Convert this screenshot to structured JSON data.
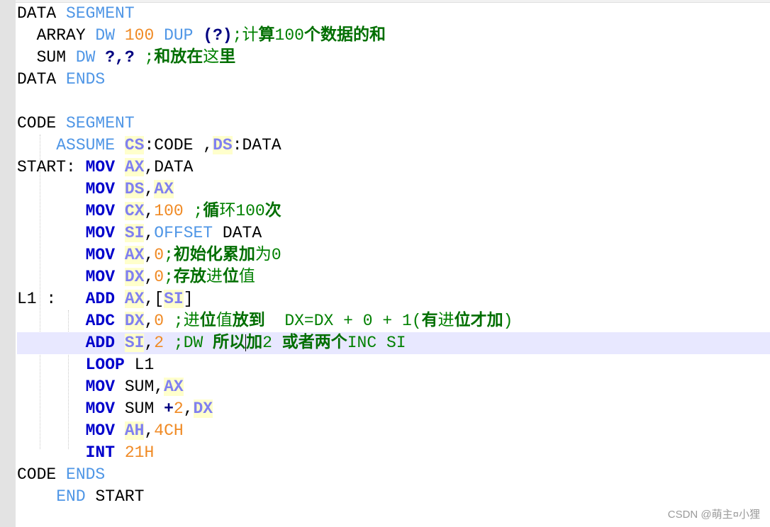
{
  "lines": [
    {
      "segs": [
        {
          "t": "DATA "
        },
        {
          "t": "SEGMENT",
          "c": "kw"
        }
      ]
    },
    {
      "segs": [
        {
          "t": "  ARRAY "
        },
        {
          "t": "DW",
          "c": "kw"
        },
        {
          "t": " "
        },
        {
          "t": "100",
          "c": "num"
        },
        {
          "t": " "
        },
        {
          "t": "DUP",
          "c": "kw"
        },
        {
          "t": " "
        },
        {
          "t": "(?)",
          "c": "punc"
        },
        {
          "t": ";计",
          "c": "cmt"
        },
        {
          "t": "算",
          "c": "cmt-b"
        },
        {
          "t": "100",
          "c": "cmt"
        },
        {
          "t": "个数据的和",
          "c": "cmt-b"
        }
      ]
    },
    {
      "segs": [
        {
          "t": "  SUM "
        },
        {
          "t": "DW",
          "c": "kw"
        },
        {
          "t": " "
        },
        {
          "t": "?,?",
          "c": "punc"
        },
        {
          "t": " "
        },
        {
          "t": ";",
          "c": "cmt"
        },
        {
          "t": "和放在",
          "c": "cmt-b"
        },
        {
          "t": "这",
          "c": "cmt"
        },
        {
          "t": "里",
          "c": "cmt-b"
        }
      ]
    },
    {
      "segs": [
        {
          "t": "DATA "
        },
        {
          "t": "ENDS",
          "c": "kw"
        }
      ]
    },
    {
      "segs": [
        {
          "t": ""
        }
      ]
    },
    {
      "segs": [
        {
          "t": "CODE "
        },
        {
          "t": "SEGMENT",
          "c": "kw"
        }
      ]
    },
    {
      "segs": [
        {
          "t": "    "
        },
        {
          "t": "ASSUME",
          "c": "kw"
        },
        {
          "t": " "
        },
        {
          "t": "CS",
          "c": "reg"
        },
        {
          "t": ":CODE ,"
        },
        {
          "t": "DS",
          "c": "reg"
        },
        {
          "t": ":DATA"
        }
      ]
    },
    {
      "segs": [
        {
          "t": "START: "
        },
        {
          "t": "MOV",
          "c": "op"
        },
        {
          "t": " "
        },
        {
          "t": "AX",
          "c": "reg"
        },
        {
          "t": ",DATA"
        }
      ]
    },
    {
      "segs": [
        {
          "t": "       "
        },
        {
          "t": "MOV",
          "c": "op"
        },
        {
          "t": " "
        },
        {
          "t": "DS",
          "c": "reg"
        },
        {
          "t": ","
        },
        {
          "t": "AX",
          "c": "reg"
        }
      ]
    },
    {
      "segs": [
        {
          "t": "       "
        },
        {
          "t": "MOV",
          "c": "op"
        },
        {
          "t": " "
        },
        {
          "t": "CX",
          "c": "reg"
        },
        {
          "t": ","
        },
        {
          "t": "100",
          "c": "num"
        },
        {
          "t": " "
        },
        {
          "t": ";",
          "c": "cmt"
        },
        {
          "t": "循",
          "c": "cmt-b"
        },
        {
          "t": "环100",
          "c": "cmt"
        },
        {
          "t": "次",
          "c": "cmt-b"
        }
      ]
    },
    {
      "segs": [
        {
          "t": "       "
        },
        {
          "t": "MOV",
          "c": "op"
        },
        {
          "t": " "
        },
        {
          "t": "SI",
          "c": "reg"
        },
        {
          "t": ","
        },
        {
          "t": "OFFSET",
          "c": "kw"
        },
        {
          "t": " DATA"
        }
      ]
    },
    {
      "segs": [
        {
          "t": "       "
        },
        {
          "t": "MOV",
          "c": "op"
        },
        {
          "t": " "
        },
        {
          "t": "AX",
          "c": "reg"
        },
        {
          "t": ","
        },
        {
          "t": "0",
          "c": "num"
        },
        {
          "t": ";",
          "c": "cmt"
        },
        {
          "t": "初始化累加",
          "c": "cmt-b"
        },
        {
          "t": "为0",
          "c": "cmt"
        }
      ]
    },
    {
      "segs": [
        {
          "t": "       "
        },
        {
          "t": "MOV",
          "c": "op"
        },
        {
          "t": " "
        },
        {
          "t": "DX",
          "c": "reg"
        },
        {
          "t": ","
        },
        {
          "t": "0",
          "c": "num"
        },
        {
          "t": ";",
          "c": "cmt"
        },
        {
          "t": "存放",
          "c": "cmt-b"
        },
        {
          "t": "进",
          "c": "cmt"
        },
        {
          "t": "位",
          "c": "cmt-b"
        },
        {
          "t": "值",
          "c": "cmt"
        }
      ]
    },
    {
      "segs": [
        {
          "t": "L1 :   "
        },
        {
          "t": "ADD",
          "c": "op"
        },
        {
          "t": " "
        },
        {
          "t": "AX",
          "c": "reg"
        },
        {
          "t": ",["
        },
        {
          "t": "SI",
          "c": "reg"
        },
        {
          "t": "]"
        }
      ]
    },
    {
      "segs": [
        {
          "t": "       "
        },
        {
          "t": "ADC",
          "c": "op"
        },
        {
          "t": " "
        },
        {
          "t": "DX",
          "c": "reg"
        },
        {
          "t": ","
        },
        {
          "t": "0",
          "c": "num"
        },
        {
          "t": " "
        },
        {
          "t": ";进",
          "c": "cmt"
        },
        {
          "t": "位",
          "c": "cmt-b"
        },
        {
          "t": "值",
          "c": "cmt"
        },
        {
          "t": "放到",
          "c": "cmt-b"
        },
        {
          "t": "  DX=DX + 0 + 1(",
          "c": "cmt"
        },
        {
          "t": "有",
          "c": "cmt-b"
        },
        {
          "t": "进",
          "c": "cmt"
        },
        {
          "t": "位才加",
          "c": "cmt-b"
        },
        {
          "t": ")",
          "c": "cmt"
        }
      ]
    },
    {
      "current": true,
      "segs": [
        {
          "t": "       "
        },
        {
          "t": "ADD",
          "c": "op"
        },
        {
          "t": " "
        },
        {
          "t": "SI",
          "c": "reg"
        },
        {
          "t": ","
        },
        {
          "t": "2",
          "c": "num"
        },
        {
          "t": " "
        },
        {
          "t": ";DW ",
          "c": "cmt"
        },
        {
          "t": "所以",
          "c": "cmt-b"
        },
        {
          "t": "|",
          "c": "caret"
        },
        {
          "t": "加",
          "c": "cmt-b"
        },
        {
          "t": "2 ",
          "c": "cmt"
        },
        {
          "t": "或者两个",
          "c": "cmt-b"
        },
        {
          "t": "INC SI",
          "c": "cmt"
        }
      ]
    },
    {
      "segs": [
        {
          "t": "       "
        },
        {
          "t": "LOOP",
          "c": "op"
        },
        {
          "t": " L1"
        }
      ]
    },
    {
      "segs": [
        {
          "t": "       "
        },
        {
          "t": "MOV",
          "c": "op"
        },
        {
          "t": " SUM,"
        },
        {
          "t": "AX",
          "c": "reg"
        }
      ]
    },
    {
      "segs": [
        {
          "t": "       "
        },
        {
          "t": "MOV",
          "c": "op"
        },
        {
          "t": " SUM "
        },
        {
          "t": "+",
          "c": "punc"
        },
        {
          "t": "2",
          "c": "num"
        },
        {
          "t": ","
        },
        {
          "t": "DX",
          "c": "reg"
        }
      ]
    },
    {
      "segs": [
        {
          "t": "       "
        },
        {
          "t": "MOV",
          "c": "op"
        },
        {
          "t": " "
        },
        {
          "t": "AH",
          "c": "reg"
        },
        {
          "t": ","
        },
        {
          "t": "4CH",
          "c": "num"
        }
      ]
    },
    {
      "segs": [
        {
          "t": "       "
        },
        {
          "t": "INT",
          "c": "op"
        },
        {
          "t": " "
        },
        {
          "t": "21H",
          "c": "num"
        }
      ]
    },
    {
      "segs": [
        {
          "t": "CODE "
        },
        {
          "t": "ENDS",
          "c": "kw"
        }
      ]
    },
    {
      "segs": [
        {
          "t": "    "
        },
        {
          "t": "END",
          "c": "kw"
        },
        {
          "t": " START"
        }
      ]
    }
  ],
  "colors": {
    "keyword": "#4f96e6",
    "number": "#f08a24",
    "register": "#8080f0",
    "register_bg": "#ffffcc",
    "opcode": "#0000cc",
    "comment": "#008000",
    "current_line_bg": "#e8e8ff",
    "gutter": "#e3e3e3"
  },
  "watermark": "CSDN @萌主¤小狸"
}
